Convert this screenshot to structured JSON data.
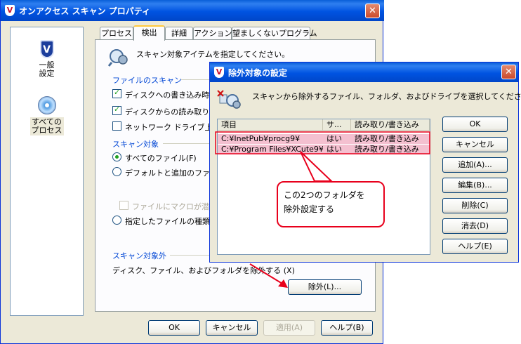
{
  "main_window": {
    "title": "オンアクセス スキャン プロパティ",
    "close_glyph": "✕",
    "sidebar": {
      "items": [
        {
          "label": "一般\n設定",
          "icon": "shield-v-icon"
        },
        {
          "label": "すべての\nプロセス",
          "icon": "disc-icon"
        }
      ]
    },
    "tabs": [
      "プロセス",
      "検出",
      "詳細",
      "アクション",
      "望ましくないプログラム"
    ],
    "active_tab": "検出",
    "panel": {
      "header_text": "スキャン対象アイテムを指定してください。",
      "file_scan": {
        "label": "ファイルのスキャン",
        "options": [
          {
            "label": "ディスクへの書き込み時(",
            "checked": true
          },
          {
            "label": "ディスクからの読み取り時(",
            "checked": true
          },
          {
            "label": "ネットワーク ドライブ上(E)",
            "checked": false
          }
        ]
      },
      "scan_target": {
        "label": "スキャン対象",
        "options": [
          {
            "label": "すべてのファイル(F)",
            "selected": true
          },
          {
            "label": "デフォルトと追加のファイル",
            "selected": false
          },
          {
            "label": "指定したファイルの種類(H",
            "selected": false
          }
        ],
        "macro_option": "ファイルにマクロが潜んでい"
      },
      "exclusions": {
        "label": "スキャン対象外",
        "description": "ディスク、ファイル、およびフォルダを除外する",
        "desc_suffix": "(X)",
        "button": "除外(L)..."
      }
    },
    "footer": {
      "ok": "OK",
      "cancel": "キャンセル",
      "apply": "適用(A)",
      "help": "ヘルプ(B)"
    }
  },
  "dialog": {
    "title": "除外対象の設定",
    "close_glyph": "✕",
    "instruction": "スキャンから除外するファイル、フォルダ、およびドライブを選択してください。",
    "columns": [
      "項目",
      "サ...",
      "読み取り/書き込み"
    ],
    "rows": [
      {
        "item": "C:¥InetPub¥procg9¥",
        "sub": "はい",
        "rw": "読み取り/書き込み"
      },
      {
        "item": "C:¥Program Files¥XCute9¥",
        "sub": "はい",
        "rw": "読み取り/書き込み"
      }
    ],
    "buttons": {
      "ok": "OK",
      "cancel": "キャンセル",
      "add": "追加(A)...",
      "edit": "編集(B)...",
      "delete": "削除(C)",
      "clear": "消去(D)",
      "help": "ヘルプ(E)"
    }
  },
  "annotation": {
    "callout_text": "この2つのフォルダを\n除外設定する",
    "color": "#e8001c"
  },
  "colors": {
    "titlebar": "#0053e1",
    "window_face": "#ece9d8",
    "group_label": "#0046d5",
    "row_highlight": "#f4c0d0"
  }
}
